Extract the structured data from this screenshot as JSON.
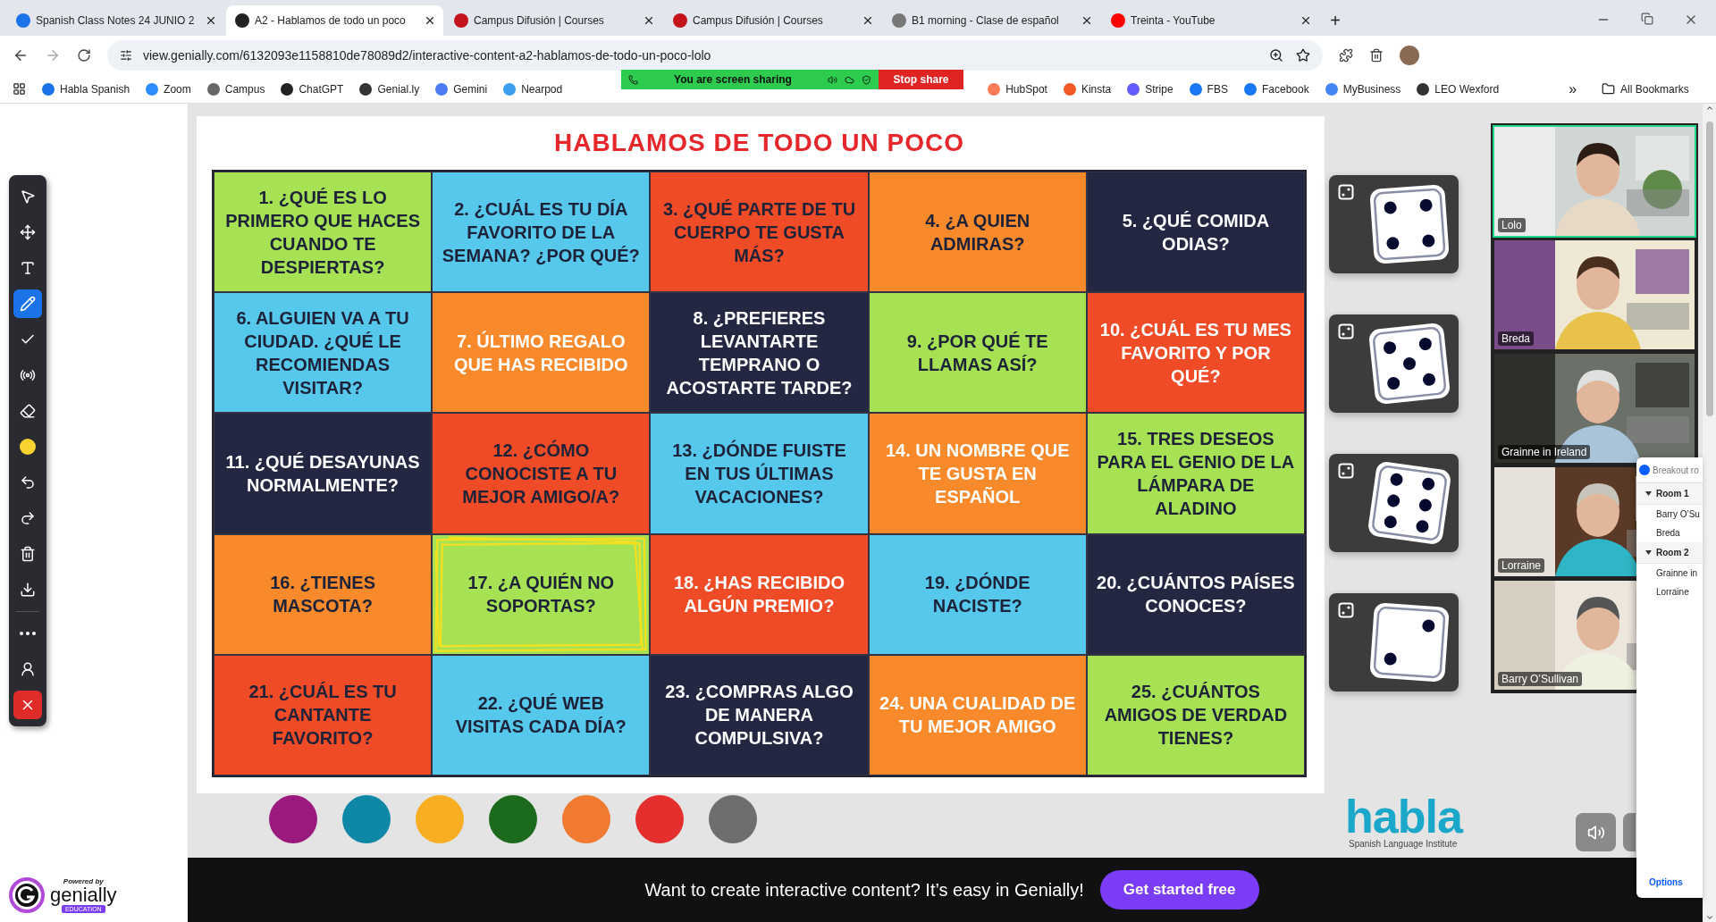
{
  "browser": {
    "tabs": [
      {
        "title": "Spanish Class Notes 24 JUNIO 2",
        "selected": false
      },
      {
        "title": "A2 - Hablamos de todo un poco",
        "selected": true
      },
      {
        "title": "Campus Difusión | Courses",
        "selected": false
      },
      {
        "title": "Campus Difusión | Courses",
        "selected": false
      },
      {
        "title": "B1 morning - Clase de español",
        "selected": false
      },
      {
        "title": "Treinta - YouTube",
        "selected": false
      }
    ],
    "new_tab": "+",
    "address": "view.genially.com/6132093e1158810de78089d2/interactive-content-a2-hablamos-de-todo-un-poco-lolo",
    "bookmarks_left": [
      "Habla Spanish",
      "Zoom",
      "Campus",
      "ChatGPT",
      "Genial.ly",
      "Gemini",
      "Nearpod"
    ],
    "bookmarks_right": [
      "HubSpot",
      "Kinsta",
      "Stripe",
      "FBS",
      "Facebook",
      "MyBusiness",
      "LEO Wexford"
    ],
    "more_bookmarks": "»",
    "all_bookmarks": "All Bookmarks"
  },
  "share_banner": {
    "status": "You are screen sharing",
    "stop": "Stop share"
  },
  "toolbar": [
    {
      "kind": "pointer",
      "selected": false
    },
    {
      "kind": "move",
      "selected": false
    },
    {
      "kind": "text",
      "selected": false
    },
    {
      "kind": "pen",
      "selected": true
    },
    {
      "kind": "check",
      "selected": false
    },
    {
      "kind": "spotlight",
      "selected": false
    },
    {
      "kind": "eraser",
      "selected": false
    },
    {
      "kind": "color",
      "selected": false,
      "color": "#f7d330"
    },
    {
      "kind": "undo",
      "selected": false
    },
    {
      "kind": "redo",
      "selected": false
    },
    {
      "kind": "delete",
      "selected": false
    },
    {
      "kind": "download",
      "selected": false
    },
    {
      "kind": "more",
      "selected": false
    },
    {
      "kind": "user",
      "selected": false
    },
    {
      "kind": "close",
      "selected": false
    }
  ],
  "powered": {
    "caption": "Powered by",
    "brand": "genially",
    "badge": "EDUCATION"
  },
  "slide": {
    "title": "HABLAMOS DE TODO UN POCO",
    "cells": [
      {
        "text": "1. ¿QUÉ ES LO PRIMERO QUE HACES CUANDO TE DESPIERTAS?",
        "color": "#a6e253",
        "kind": "dark_text",
        "highlighted": false
      },
      {
        "text": "2. ¿CUÁL ES TU DÍA FAVORITO DE LA SEMANA? ¿POR QUÉ?",
        "color": "#56c8ec",
        "kind": "dark_text",
        "highlighted": false
      },
      {
        "text": "3. ¿QUÉ PARTE DE TU CUERPO TE GUSTA MÁS?",
        "color": "#ee4b26",
        "kind": "dark_text",
        "highlighted": false
      },
      {
        "text": "4. ¿A QUIEN ADMIRAS?",
        "color": "#f98a2b",
        "kind": "dark_text",
        "highlighted": false
      },
      {
        "text": "5. ¿QUÉ COMIDA ODIAS?",
        "color": "#232742",
        "kind": "light_text",
        "highlighted": false
      },
      {
        "text": "6. ALGUIEN VA A TU CIUDAD. ¿QUÉ LE RECOMIENDAS VISITAR?",
        "color": "#56c8ec",
        "kind": "dark_text",
        "highlighted": false
      },
      {
        "text": "7. ÚLTIMO REGALO QUE HAS RECIBIDO",
        "color": "#f98a2b",
        "kind": "light_text",
        "highlighted": false
      },
      {
        "text": "8. ¿PREFIERES LEVANTARTE TEMPRANO O ACOSTARTE TARDE?",
        "color": "#232742",
        "kind": "light_text",
        "highlighted": false
      },
      {
        "text": "9. ¿POR QUÉ TE LLAMAS ASÍ?",
        "color": "#a6e253",
        "kind": "dark_text",
        "highlighted": false
      },
      {
        "text": "10. ¿CUÁL ES TU MES FAVORITO Y POR QUÉ?",
        "color": "#ee4b26",
        "kind": "light_text",
        "highlighted": false
      },
      {
        "text": "11. ¿QUÉ DESAYUNAS NORMALMENTE?",
        "color": "#232742",
        "kind": "light_text",
        "highlighted": false
      },
      {
        "text": "12. ¿CÓMO CONOCISTE A TU MEJOR AMIGO/A?",
        "color": "#ee4b26",
        "kind": "dark_text",
        "highlighted": false
      },
      {
        "text": "13. ¿DÓNDE FUISTE EN TUS ÚLTIMAS VACACIONES?",
        "color": "#56c8ec",
        "kind": "dark_text",
        "highlighted": false
      },
      {
        "text": "14. UN NOMBRE QUE TE GUSTA EN ESPAÑOL",
        "color": "#f98a2b",
        "kind": "light_text",
        "highlighted": false
      },
      {
        "text": "15. TRES DESEOS PARA EL GENIO DE LA LÁMPARA DE ALADINO",
        "color": "#a6e253",
        "kind": "dark_text",
        "highlighted": false
      },
      {
        "text": "16. ¿TIENES MASCOTA?",
        "color": "#f98a2b",
        "kind": "dark_text",
        "highlighted": false
      },
      {
        "text": "17. ¿A QUIÉN NO SOPORTAS?",
        "color": "#a6e253",
        "kind": "dark_text",
        "highlighted": true
      },
      {
        "text": "18. ¿HAS RECIBIDO ALGÚN PREMIO?",
        "color": "#ee4b26",
        "kind": "light_text",
        "highlighted": false
      },
      {
        "text": "19. ¿DÓNDE NACISTE?",
        "color": "#56c8ec",
        "kind": "dark_text",
        "highlighted": false
      },
      {
        "text": "20. ¿CUÁNTOS PAÍSES CONOCES?",
        "color": "#232742",
        "kind": "light_text",
        "highlighted": false
      },
      {
        "text": "21. ¿CUÁL ES TU CANTANTE FAVORITO?",
        "color": "#ee4b26",
        "kind": "dark_text",
        "highlighted": false
      },
      {
        "text": "22. ¿QUÉ WEB VISITAS CADA DÍA?",
        "color": "#56c8ec",
        "kind": "dark_text",
        "highlighted": false
      },
      {
        "text": "23. ¿COMPRAS ALGO DE MANERA COMPULSIVA?",
        "color": "#232742",
        "kind": "light_text",
        "highlighted": false
      },
      {
        "text": "24. UNA CUALIDAD DE TU MEJOR AMIGO",
        "color": "#f98a2b",
        "kind": "light_text",
        "highlighted": false
      },
      {
        "text": "25. ¿CUÁNTOS AMIGOS DE VERDAD TIENES?",
        "color": "#a6e253",
        "kind": "dark_text",
        "highlighted": false
      }
    ]
  },
  "dice": [
    {
      "kind": "four"
    },
    {
      "kind": "five"
    },
    {
      "kind": "six"
    },
    {
      "kind": "two"
    }
  ],
  "palette": [
    {
      "color": "#9c1a7e"
    },
    {
      "color": "#0f88a8"
    },
    {
      "color": "#f7ae23"
    },
    {
      "color": "#1c6b1d"
    },
    {
      "color": "#ef7a30"
    },
    {
      "color": "#e52e2e"
    },
    {
      "color": "#6e6e6e"
    }
  ],
  "logo": {
    "name": "habla",
    "tagline": "Spanish Language Institute"
  },
  "video_gallery": [
    {
      "name": "Lolo",
      "speaking": true
    },
    {
      "name": "Breda",
      "speaking": false
    },
    {
      "name": "Grainne in Ireland",
      "speaking": false
    },
    {
      "name": "Lorraine",
      "speaking": false
    },
    {
      "name": "Barry O’Sullivan",
      "speaking": false
    }
  ],
  "breakout_panel": {
    "title": "Breakout ro",
    "rooms": [
      {
        "name": "Room 1",
        "expanded": true,
        "members": [
          "Barry O’Su",
          "Breda"
        ]
      },
      {
        "name": "Room 2",
        "expanded": true,
        "members": [
          "Grainne in",
          "Lorraine"
        ]
      }
    ],
    "options": "Options"
  },
  "promo_bar": {
    "text": "Want to create interactive content? It’s easy in Genially!",
    "button": "Get started free"
  }
}
